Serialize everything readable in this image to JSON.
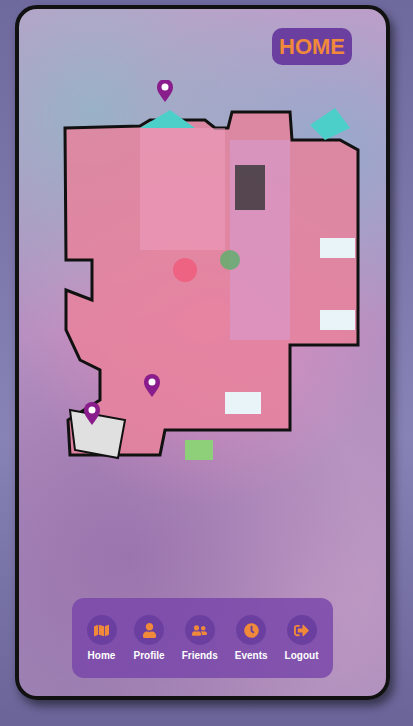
{
  "header": {
    "home_button": "HOME"
  },
  "map": {
    "title": ""
  },
  "nav": {
    "items": [
      {
        "label": "Home"
      },
      {
        "label": "Profile"
      },
      {
        "label": "Friends"
      },
      {
        "label": "Events"
      },
      {
        "label": "Logout"
      }
    ]
  }
}
